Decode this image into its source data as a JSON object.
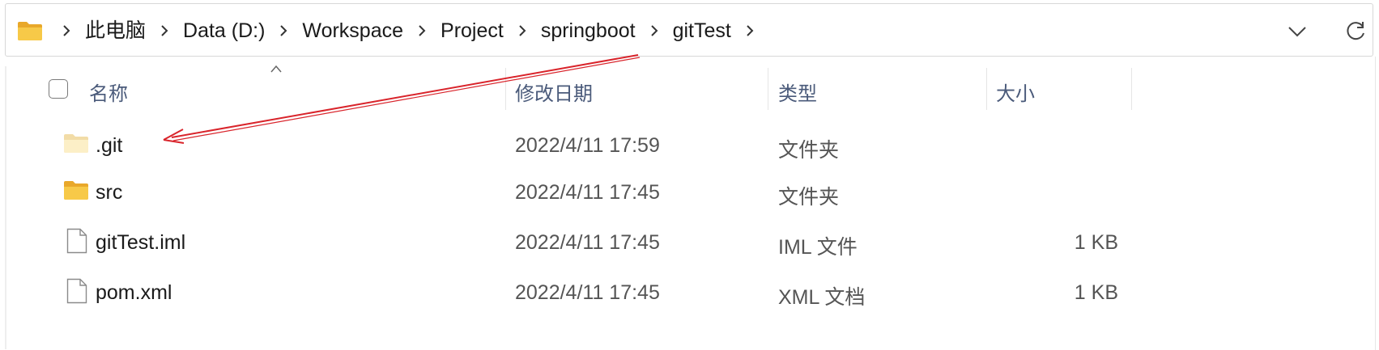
{
  "address_bar": {
    "crumbs": [
      "此电脑",
      "Data (D:)",
      "Workspace",
      "Project",
      "springboot",
      "gitTest"
    ]
  },
  "header": {
    "name": "名称",
    "modified": "修改日期",
    "type": "类型",
    "size": "大小"
  },
  "files": [
    {
      "name": ".git",
      "modified": "2022/4/11 17:59",
      "type": "文件夹",
      "size": "",
      "icon": "folder-hidden-icon"
    },
    {
      "name": "src",
      "modified": "2022/4/11 17:45",
      "type": "文件夹",
      "size": "",
      "icon": "folder-icon"
    },
    {
      "name": "gitTest.iml",
      "modified": "2022/4/11 17:45",
      "type": "IML 文件",
      "size": "1 KB",
      "icon": "file-icon"
    },
    {
      "name": "pom.xml",
      "modified": "2022/4/11 17:45",
      "type": "XML 文档",
      "size": "1 KB",
      "icon": "file-icon"
    }
  ],
  "colors": {
    "annotation_arrow": "#d9242b",
    "folder": "#f3c13a",
    "header_text": "#4a5a7a"
  }
}
